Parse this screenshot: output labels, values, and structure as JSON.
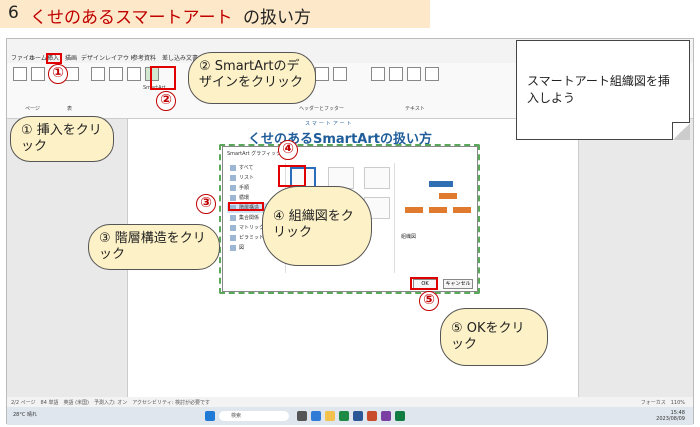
{
  "heading": {
    "num": "6",
    "red_part": "くせのあるスマートアート",
    "black_part": "の扱い方"
  },
  "word": {
    "tabs": [
      "ファイル",
      "ホーム",
      "挿入",
      "描画",
      "デザイン",
      "レイアウト",
      "参考資料",
      "差し込み文書",
      "校閲"
    ],
    "ribbon_groups": [
      "ページ",
      "表",
      "SmartArt",
      "ヘッダーとフッター",
      "テキスト"
    ],
    "doc_title": "くせのあるSmartArtの扱い方",
    "doc_ruby": "スマートアート",
    "status_left": "2/2 ページ　84 単語　英語 (米国)　予測入力: オン　アクセシビリティ: 検討が必要です",
    "status_right": "フォーカス　110%",
    "weather": "28°C 晴れ",
    "search": "検索",
    "clock": "15:48 2023/08/09"
  },
  "dialog": {
    "title": "SmartArt グラフィックの選択",
    "categories": [
      "すべて",
      "リスト",
      "手順",
      "循環",
      "階層構造",
      "集合関係",
      "マトリックス",
      "ピラミッド",
      "図"
    ],
    "selected_category": "階層構造",
    "preview_title": "組織図",
    "ok": "OK",
    "cancel": "キャンセル"
  },
  "callouts": {
    "c1": "① 挿入をクリック",
    "c2": "② SmartArtのデザインをクリック",
    "c3": "③ 階層構造をクリック",
    "c4": "④ 組織図をクリック",
    "c5": "⑤ OKをクリック",
    "note": "スマートアート組織図を挿入しよう"
  },
  "badges": [
    "①",
    "②",
    "③",
    "④",
    "⑤"
  ]
}
